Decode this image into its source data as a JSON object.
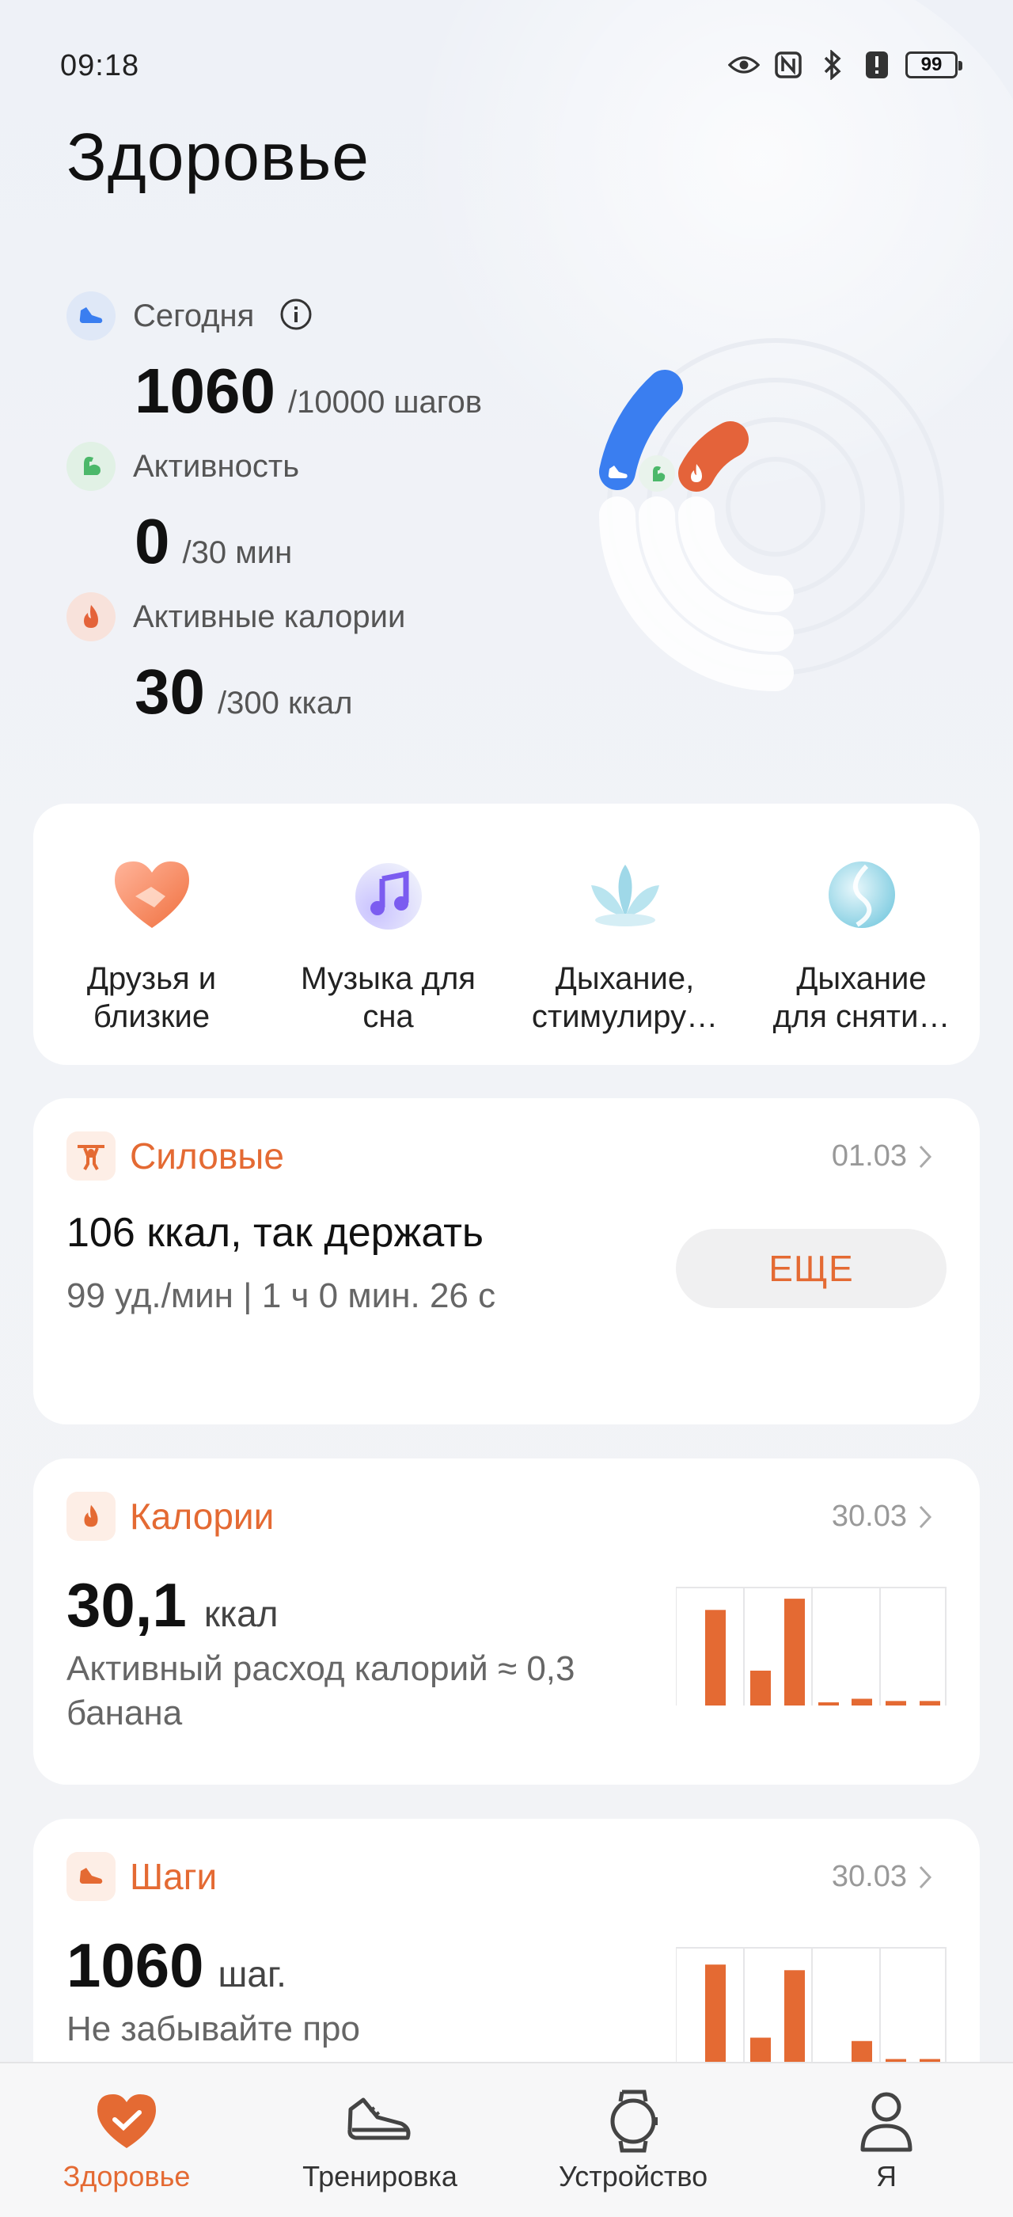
{
  "status_bar": {
    "time": "09:18",
    "icons": [
      "eye-icon",
      "nfc-icon",
      "bluetooth-icon",
      "alert-icon",
      "battery-icon"
    ],
    "battery": "99"
  },
  "page_title": "Здоровье",
  "goals": {
    "steps": {
      "label": "Сегодня",
      "value": "1060",
      "target": "/10000 шагов",
      "color": "#3a7ef0",
      "progress": 0.106
    },
    "activity": {
      "label": "Активность",
      "value": "0",
      "target": "/30 мин",
      "color": "#4cb86a",
      "progress": 0
    },
    "calories": {
      "label": "Активные калории",
      "value": "30",
      "target": "/300 ккал",
      "color": "#e4633a",
      "progress": 0.1
    }
  },
  "shortcuts": [
    {
      "label": "Друзья и\nблизкие",
      "icon": "heart-handshake-icon"
    },
    {
      "label": "Музыка для\nсна",
      "icon": "music-note-icon"
    },
    {
      "label": "Дыхание,\nстимулиру…",
      "icon": "lotus-icon"
    },
    {
      "label": "Дыхание\nдля сняти…",
      "icon": "droplet-orb-icon"
    }
  ],
  "strength_card": {
    "title": "Силовые",
    "date": "01.03",
    "main": "106 ккал, так держать",
    "sub": "99 уд./мин | 1 ч 0 мин. 26 с",
    "button": "ЕЩЕ"
  },
  "calories_card": {
    "title": "Калории",
    "date": "30.03",
    "value": "30,1",
    "unit": "ккал",
    "sub": "Активный расход калорий ≈ 0,3 банана",
    "bars": [
      0.85,
      0.31,
      0.95,
      0.02,
      0.06,
      0.04,
      0.04
    ]
  },
  "steps_card": {
    "title": "Шаги",
    "date": "30.03",
    "value": "1060",
    "unit": "шаг.",
    "sub": "Не забывайте про",
    "bars": [
      0.9,
      0.25,
      0.85,
      0.02,
      0.22,
      0.06,
      0.06
    ]
  },
  "colors": {
    "accent": "#e46a33",
    "steps": "#3a7ef0",
    "activity": "#4cb86a",
    "calories": "#e4633a"
  },
  "nav": [
    {
      "label": "Здоровье",
      "icon": "heart-check-icon",
      "active": true
    },
    {
      "label": "Тренировка",
      "icon": "sneaker-icon",
      "active": false
    },
    {
      "label": "Устройство",
      "icon": "watch-icon",
      "active": false
    },
    {
      "label": "Я",
      "icon": "person-icon",
      "active": false
    }
  ]
}
